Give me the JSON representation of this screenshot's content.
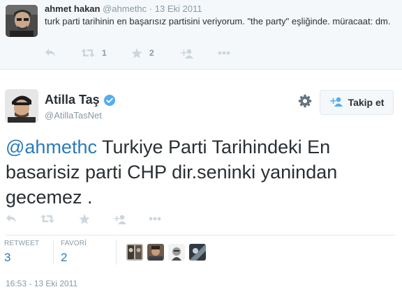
{
  "parent_tweet": {
    "name": "ahmet hakan",
    "handle": "@ahmethc",
    "separator": "·",
    "date": "13 Eki 2011",
    "text": "turk parti tarihinin en başarısız partisini veriyorum. \"the party\" eşliğinde. müracaat: dm.",
    "actions": {
      "retweet_count": "1",
      "favorite_count": "2"
    }
  },
  "main_tweet": {
    "name": "Atilla Taş",
    "handle": "@AtillaTasNet",
    "follow_label": "Takip et",
    "mention": "@ahmethc",
    "text": " Turkiye Parti Tarihindeki En basarisiz parti CHP dir.seninki yanindan gecemez .",
    "stats": {
      "retweet_label": "RETWEET",
      "retweet_count": "3",
      "favorite_label": "FAVORİ",
      "favorite_count": "2"
    },
    "timestamp": "16:53 - 13 Eki 2011"
  },
  "colors": {
    "link_blue": "#2b7bb9",
    "verified_blue": "#55acee",
    "muted_gray": "#8899a6",
    "icon_gray": "#ccd6dd"
  }
}
